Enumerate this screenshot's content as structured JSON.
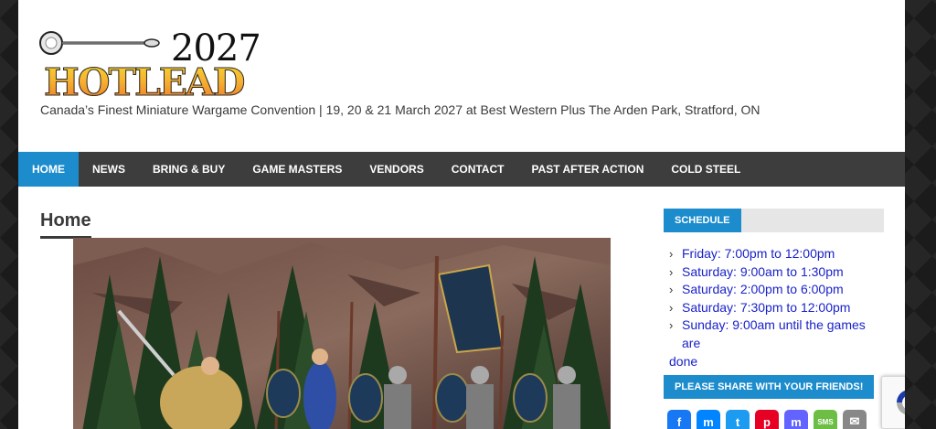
{
  "site": {
    "logo_year": "2027",
    "logo_word": "HOTLEAD",
    "tagline": "Canada’s Finest Miniature Wargame Convention | 19, 20 & 21 March 2027 at Best Western Plus The Arden Park, Stratford, ON"
  },
  "nav": {
    "items": [
      {
        "label": "HOME",
        "active": true
      },
      {
        "label": "NEWS"
      },
      {
        "label": "BRING & BUY"
      },
      {
        "label": "GAME MASTERS"
      },
      {
        "label": "VENDORS"
      },
      {
        "label": "CONTACT"
      },
      {
        "label": "PAST AFTER ACTION"
      },
      {
        "label": "COLD STEEL"
      }
    ]
  },
  "main": {
    "title": "Home"
  },
  "sidebar": {
    "schedule_title": "SCHEDULE",
    "schedule": [
      "Friday: 7:00pm to 12:00pm",
      "Saturday: 9:00am to 1:30pm",
      "Saturday: 2:00pm to 6:00pm",
      "Saturday: 7:30pm to 12:00pm",
      "Sunday: 9:00am until the games are",
      "done"
    ],
    "share_title": "PLEASE SHARE WITH YOUR FRIENDS!",
    "share_icons": [
      {
        "name": "facebook-icon",
        "glyph": "f",
        "color": "#1877f2"
      },
      {
        "name": "messenger-icon",
        "glyph": "m",
        "color": "#0084ff"
      },
      {
        "name": "twitter-icon",
        "glyph": "t",
        "color": "#1d9bf0"
      },
      {
        "name": "pinterest-icon",
        "glyph": "p",
        "color": "#e60023"
      },
      {
        "name": "mastodon-icon",
        "glyph": "m",
        "color": "#6364ff"
      },
      {
        "name": "sms-icon",
        "glyph": "SMS",
        "color": "#6cbe45"
      },
      {
        "name": "email-icon",
        "glyph": "✉",
        "color": "#888888"
      }
    ]
  },
  "colors": {
    "accent": "#1c8ccd",
    "nav_bg": "#3d3d3d",
    "link": "#1a22c8"
  }
}
